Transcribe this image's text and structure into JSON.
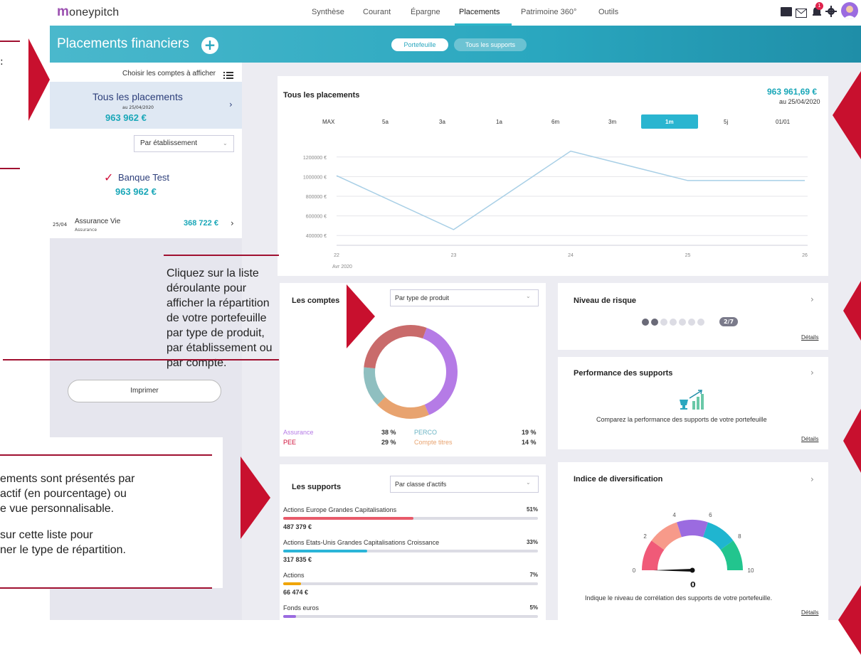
{
  "app": {
    "logo_mark": "m",
    "logo_text": "oneypitch"
  },
  "nav": {
    "items": [
      "Synthèse",
      "Courant",
      "Épargne",
      "Placements",
      "Patrimoine 360°",
      "Outils"
    ],
    "active": "Placements",
    "notification_count": "1"
  },
  "header": {
    "title": "Placements financiers",
    "add_label": "+",
    "tabs": [
      "Portefeuille",
      "Tous les supports"
    ]
  },
  "left": {
    "choose_label": "Choisir les comptes à afficher",
    "all": {
      "label": "Tous les placements",
      "date": "au 25/04/2020",
      "amount": "963 962 €"
    },
    "grouping_select": "Par établissement",
    "bank": {
      "name": "Banque Test",
      "amount": "963 962 €"
    },
    "account": {
      "date": "25/04",
      "name": "Assurance Vie",
      "type": "Assurance",
      "amount": "368 722 €"
    },
    "print_label": "Imprimer"
  },
  "callouts": {
    "c2": "Cliquez sur la liste déroulante pour afficher la répartition de votre portefeuille par type de produit, par établissement ou par compte.",
    "c3_line1": "ements sont présentés par",
    "c3_line2": "actif (en pourcentage) ou",
    "c3_line3": "e vue personnalisable.",
    "c3_line4": "sur cette liste pour",
    "c3_line5": "ner le type de répartition."
  },
  "overview": {
    "title": "Tous les placements",
    "amount": "963 961,69 €",
    "date": "au 25/04/2020",
    "periods": [
      "MAX",
      "5a",
      "3a",
      "1a",
      "6m",
      "3m",
      "1m",
      "5j",
      "01/01"
    ],
    "active_period": "1m"
  },
  "chart_data": {
    "type": "line",
    "x": [
      "22",
      "23",
      "24",
      "25",
      "26"
    ],
    "x_sublabel": "Avr 2020",
    "values": [
      1010000,
      460000,
      1260000,
      960000,
      960000
    ],
    "y_ticks": [
      "1200000 €",
      "1000000 €",
      "800000 €",
      "600000 €",
      "400000 €"
    ],
    "ylim": [
      300000,
      1300000
    ],
    "color": "#a8cfe6"
  },
  "comptes": {
    "title": "Les comptes",
    "select": "Par type de produit",
    "donut": [
      {
        "name": "Assurance",
        "pct": "38 %",
        "value": 38,
        "color": "#b57be6"
      },
      {
        "name": "PERCO",
        "pct": "19 %",
        "value": 19,
        "color": "#e8a36f"
      },
      {
        "name": "PEE",
        "pct": "29 %",
        "value": 29,
        "color": "#c96b6b"
      },
      {
        "name": "Compte titres",
        "pct": "14 %",
        "value": 14,
        "color": "#8fbfc0"
      }
    ]
  },
  "risk": {
    "title": "Niveau de risque",
    "level": 2,
    "max": 7,
    "badge": "2/7",
    "details": "Détails"
  },
  "performance": {
    "title": "Performance des supports",
    "text": "Comparez la performance des supports de votre portefeuille",
    "details": "Détails"
  },
  "supports": {
    "title": "Les supports",
    "select": "Par classe d'actifs",
    "items": [
      {
        "name": "Actions Europe Grandes Capitalisations",
        "pct": "51%",
        "value": 51,
        "amount": "487 379 €",
        "color": "#e85a6a"
      },
      {
        "name": "Actions Etats-Unis Grandes Capitalisations Croissance",
        "pct": "33%",
        "value": 33,
        "amount": "317 835 €",
        "color": "#2bb5d8"
      },
      {
        "name": "Actions",
        "pct": "7%",
        "value": 7,
        "amount": "66 474 €",
        "color": "#f0a500"
      },
      {
        "name": "Fonds euros",
        "pct": "5%",
        "value": 5,
        "amount": "",
        "color": "#9b6be0"
      }
    ]
  },
  "diversification": {
    "title": "Indice de diversification",
    "ticks": [
      "0",
      "2",
      "4",
      "6",
      "8",
      "10"
    ],
    "value": "0",
    "text": "Indique le niveau de corrélation des supports de votre portefeuille.",
    "details": "Détails",
    "segments": [
      "#f05a78",
      "#f79a8a",
      "#9b6be0",
      "#1fb5d0",
      "#22c58e"
    ]
  }
}
